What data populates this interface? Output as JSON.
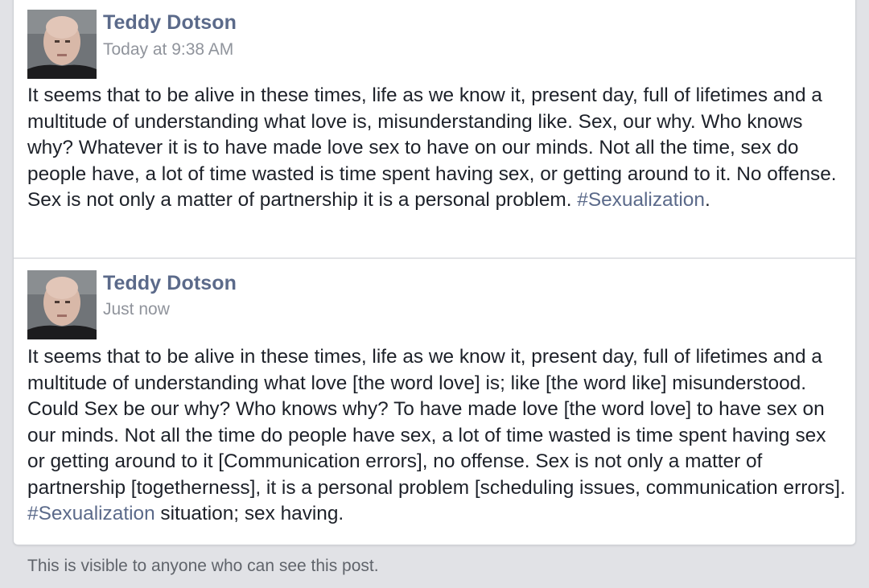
{
  "posts": [
    {
      "author": "Teddy Dotson",
      "timestamp": "Today at 9:38 AM",
      "text_before_hashtag": "It seems that to be alive in these times, life as we know it, present day, full of lifetimes and a multitude of understanding what love is, misunderstanding like. Sex, our why. Who knows why? Whatever it is to have made love sex to have on our minds. Not all the time, sex do people have, a lot of time wasted is time spent having sex, or getting around to it. No offense. Sex is not only a matter of partnership it is a personal problem. ",
      "hashtag": "#Sexualization",
      "text_after_hashtag": "."
    },
    {
      "author": "Teddy Dotson",
      "timestamp": "Just now",
      "text_before_hashtag": "It seems that to be alive in these times, life as we know it, present day, full of lifetimes and a multitude of understanding what love [the word love] is; like [the word like] misunderstood. Could Sex be our why? Who knows why? To have made love [the word love] to have sex on our minds. Not all the time do people have sex, a lot of time wasted is time spent having sex or getting around to it [Communication errors], no offense. Sex is not only a matter of partnership [togetherness], it is a personal problem [scheduling issues, communication errors]. ",
      "hashtag": "#Sexualization",
      "text_after_hashtag": " situation; sex having."
    }
  ],
  "footer": {
    "visibility_note": "This is visible to anyone who can see this post."
  },
  "colors": {
    "name_link": "#5b6a8a",
    "hashtag_link": "#5b6a8a",
    "timestamp": "#90949c",
    "body_text": "#1d2129",
    "background": "#e1e2e6"
  }
}
